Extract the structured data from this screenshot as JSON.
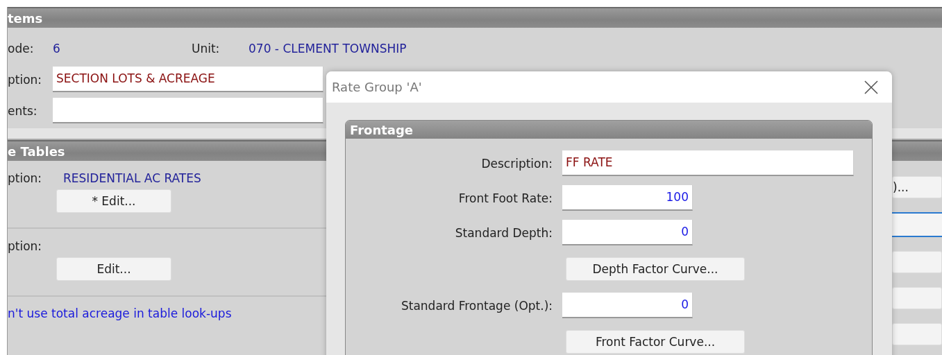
{
  "background": {
    "sections": [
      {
        "title": "tems",
        "code_label": "ode:",
        "code_value": "6",
        "unit_label": "Unit:",
        "unit_value": "070 - CLEMENT TOWNSHIP",
        "description_label": "ption:",
        "description_value": "SECTION LOTS & ACREAGE",
        "comments_label": "ents:"
      },
      {
        "title": "e Tables",
        "tables": [
          {
            "label": "ption:",
            "value": "RESIDENTIAL AC RATES",
            "button": "* Edit..."
          },
          {
            "label": "ption:",
            "button": "Edit..."
          }
        ],
        "note": "n't use total acreage in table look-ups",
        "right_controls": [
          {
            "kind": "button",
            "label": ")..."
          },
          {
            "kind": "field",
            "focused": true
          },
          {
            "kind": "button"
          },
          {
            "kind": "button"
          },
          {
            "kind": "button"
          }
        ]
      }
    ]
  },
  "dialog": {
    "title": "Rate Group 'A'",
    "group": {
      "title": "Frontage",
      "rows": [
        {
          "kind": "text",
          "label": "Description:",
          "value": "FF RATE"
        },
        {
          "kind": "number",
          "label": "Front Foot Rate:",
          "value": "100"
        },
        {
          "kind": "number",
          "label": "Standard Depth:",
          "value": "0"
        },
        {
          "kind": "button",
          "label": "Depth Factor Curve..."
        },
        {
          "kind": "number",
          "label": "Standard Frontage (Opt.):",
          "value": "0"
        },
        {
          "kind": "button",
          "label": "Front Factor Curve..."
        }
      ]
    }
  }
}
